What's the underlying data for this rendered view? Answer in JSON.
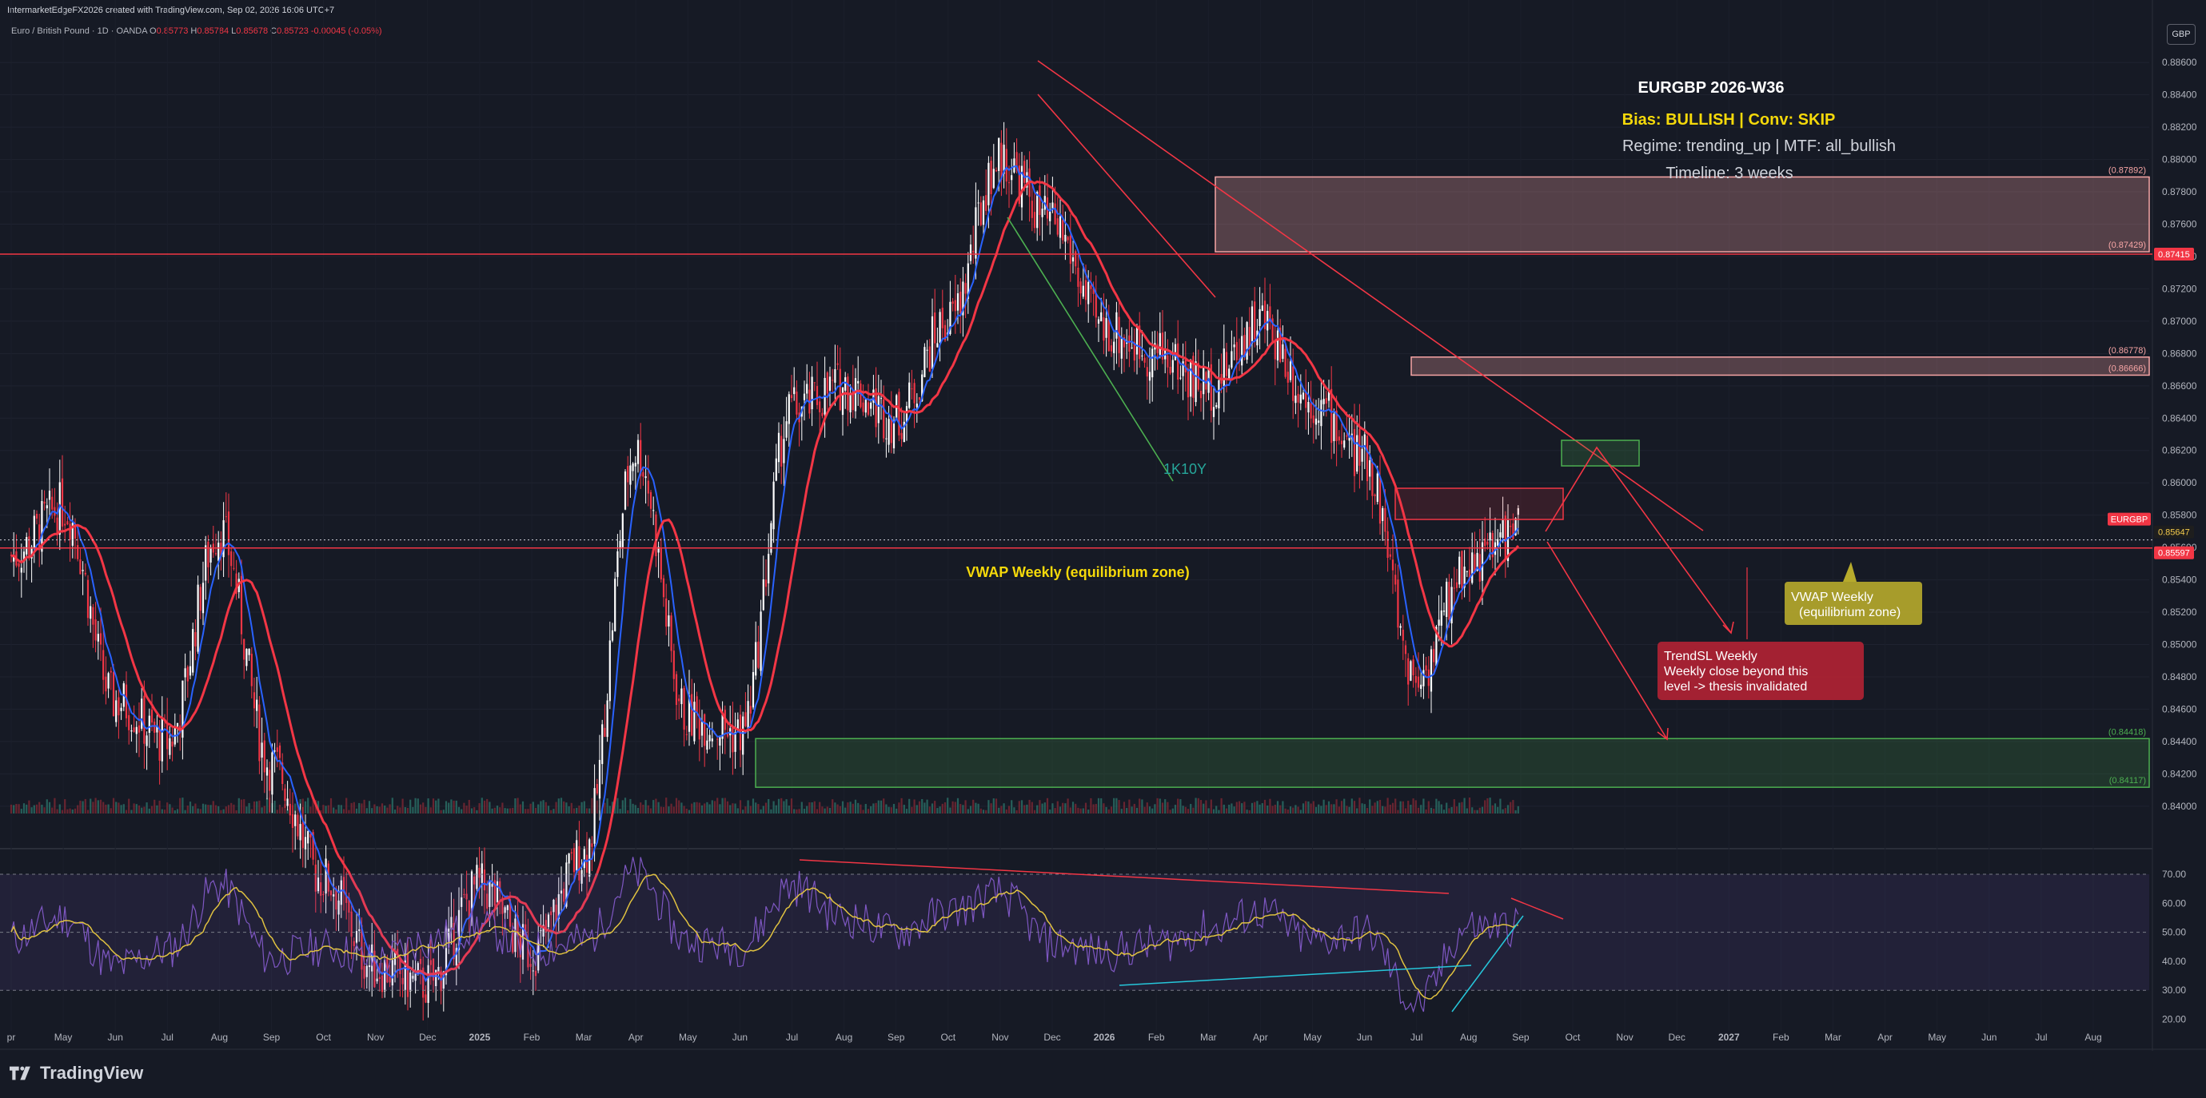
{
  "header": {
    "credit": "IntermarketEdgeFX2026 created with TradingView.com, Sep 02, 2026 16:06 UTC+7",
    "symbol": "Euro / British Pound · 1D · OANDA",
    "ohlc": [
      {
        "k": "O",
        "v": "0.85773"
      },
      {
        "k": "H",
        "v": "0.85784"
      },
      {
        "k": "L",
        "v": "0.85678"
      },
      {
        "k": "C",
        "v": "0.85723"
      }
    ],
    "change": "-0.00045 (-0.05%)",
    "currency": "GBP"
  },
  "brand": "TradingView",
  "colors": {
    "bg": "#161a25",
    "bull": "#ffffff",
    "bear": "#f23645",
    "ma_fast": "#2962ff",
    "ma_slow": "#f23645",
    "rsi": "#7e57c2",
    "rsi_ma": "#e0c240"
  },
  "chart_data": {
    "type": "candlestick",
    "title": "EURGBP 2026-W36",
    "x_axis_labels": [
      "pr",
      "May",
      "Jun",
      "Jul",
      "Aug",
      "Sep",
      "Oct",
      "Nov",
      "Dec",
      "2025",
      "Feb",
      "Mar",
      "Apr",
      "May",
      "Jun",
      "Jul",
      "Aug",
      "Sep",
      "Oct",
      "Nov",
      "Dec",
      "2026",
      "Feb",
      "Mar",
      "Apr",
      "May",
      "Jun",
      "Jul",
      "Aug",
      "Sep",
      "Oct",
      "Nov",
      "Dec",
      "2027",
      "Feb",
      "Mar",
      "Apr",
      "May",
      "Jun",
      "Jul",
      "Aug"
    ],
    "y_axis_ticks": [
      "0.88600",
      "0.88400",
      "0.88200",
      "0.88000",
      "0.87800",
      "0.87600",
      "0.87400",
      "0.87200",
      "0.87000",
      "0.86800",
      "0.86600",
      "0.86400",
      "0.86200",
      "0.86000",
      "0.85800",
      "0.85600",
      "0.85400",
      "0.85200",
      "0.85000",
      "0.84800",
      "0.84600",
      "0.84400",
      "0.84200",
      "0.84000"
    ],
    "ylim": [
      0.8392,
      0.8869
    ],
    "price_path": [
      {
        "month": "2024-04",
        "price": 0.8555
      },
      {
        "month": "2024-05",
        "price": 0.8585
      },
      {
        "month": "2024-06",
        "price": 0.8465
      },
      {
        "month": "2024-07",
        "price": 0.844
      },
      {
        "month": "2024-08",
        "price": 0.857
      },
      {
        "month": "2024-09",
        "price": 0.8425
      },
      {
        "month": "2024-10",
        "price": 0.8355
      },
      {
        "month": "2024-11",
        "price": 0.83
      },
      {
        "month": "2024-12",
        "price": 0.829
      },
      {
        "month": "2025-01",
        "price": 0.835
      },
      {
        "month": "2025-02",
        "price": 0.831
      },
      {
        "month": "2025-03",
        "price": 0.837
      },
      {
        "month": "2025-04",
        "price": 0.862
      },
      {
        "month": "2025-05",
        "price": 0.8455
      },
      {
        "month": "2025-06",
        "price": 0.8445
      },
      {
        "month": "2025-07",
        "price": 0.8645
      },
      {
        "month": "2025-08",
        "price": 0.866
      },
      {
        "month": "2025-09",
        "price": 0.864
      },
      {
        "month": "2025-10",
        "price": 0.87
      },
      {
        "month": "2025-11",
        "price": 0.88
      },
      {
        "month": "2025-12",
        "price": 0.876
      },
      {
        "month": "2026-01",
        "price": 0.8695
      },
      {
        "month": "2026-02",
        "price": 0.868
      },
      {
        "month": "2026-03",
        "price": 0.866
      },
      {
        "month": "2026-04",
        "price": 0.87
      },
      {
        "month": "2026-05",
        "price": 0.865
      },
      {
        "month": "2026-06",
        "price": 0.8615
      },
      {
        "month": "2026-07",
        "price": 0.848
      },
      {
        "month": "2026-08",
        "price": 0.855
      },
      {
        "month": "2026-09",
        "price": 0.8572
      }
    ],
    "price_labels": [
      {
        "label": "EURGBP",
        "value": "0.85647",
        "price": 0.85647
      },
      {
        "value": "0.85597",
        "price": 0.85597
      },
      {
        "value": "0.87415",
        "price": 0.87415
      }
    ],
    "zones": [
      {
        "top": 0.87892,
        "bottom": 0.87429,
        "top_label": "(0.87892)",
        "bottom_label": "(0.87429)",
        "color": "#f7a5a5"
      },
      {
        "top": 0.86778,
        "bottom": 0.86666,
        "top_label": "(0.86778)",
        "bottom_label": "(0.86666)",
        "color": "#f7a5a5"
      },
      {
        "top": 0.84418,
        "bottom": 0.84117,
        "top_label": "(0.84418)",
        "bottom_label": "(0.84117)",
        "color": "#4caf50"
      }
    ],
    "annotations": {
      "bias_line": "Bias: BULLISH | Conv: SKIP",
      "regime_line": "Regime: trending_up | MTF: all_bullish",
      "timeline_line": "Timeline: 3 weeks",
      "vwap_label": "VWAP Weekly (equilibrium zone)",
      "vwap_box_line1": "VWAP Weekly",
      "vwap_box_line2": "(equilibrium zone)",
      "trendsl_line1": "TrendSL Weekly",
      "trendsl_line2": "Weekly close beyond this",
      "trendsl_line3": "level -> thesis invalidated",
      "fib_label": "1K10Y"
    },
    "rsi": {
      "ticks": [
        "70.00",
        "60.00",
        "50.00",
        "40.00",
        "30.00",
        "20.00"
      ],
      "ylim": [
        16,
        78
      ],
      "path": [
        {
          "month": "2024-04",
          "value": 48
        },
        {
          "month": "2024-05",
          "value": 55
        },
        {
          "month": "2024-06",
          "value": 38
        },
        {
          "month": "2024-07",
          "value": 44
        },
        {
          "month": "2024-08",
          "value": 66
        },
        {
          "month": "2024-09",
          "value": 41
        },
        {
          "month": "2024-10",
          "value": 45
        },
        {
          "month": "2024-11",
          "value": 40
        },
        {
          "month": "2024-12",
          "value": 47
        },
        {
          "month": "2025-01",
          "value": 52
        },
        {
          "month": "2025-02",
          "value": 44
        },
        {
          "month": "2025-03",
          "value": 47
        },
        {
          "month": "2025-04",
          "value": 70
        },
        {
          "month": "2025-05",
          "value": 47
        },
        {
          "month": "2025-06",
          "value": 45
        },
        {
          "month": "2025-07",
          "value": 66
        },
        {
          "month": "2025-08",
          "value": 55
        },
        {
          "month": "2025-09",
          "value": 50
        },
        {
          "month": "2025-10",
          "value": 57
        },
        {
          "month": "2025-11",
          "value": 63
        },
        {
          "month": "2025-12",
          "value": 46
        },
        {
          "month": "2026-01",
          "value": 43
        },
        {
          "month": "2026-02",
          "value": 46
        },
        {
          "month": "2026-03",
          "value": 51
        },
        {
          "month": "2026-04",
          "value": 57
        },
        {
          "month": "2026-05",
          "value": 47
        },
        {
          "month": "2026-06",
          "value": 50
        },
        {
          "month": "2026-07",
          "value": 25
        },
        {
          "month": "2026-08",
          "value": 52
        },
        {
          "month": "2026-09",
          "value": 52
        }
      ]
    }
  }
}
